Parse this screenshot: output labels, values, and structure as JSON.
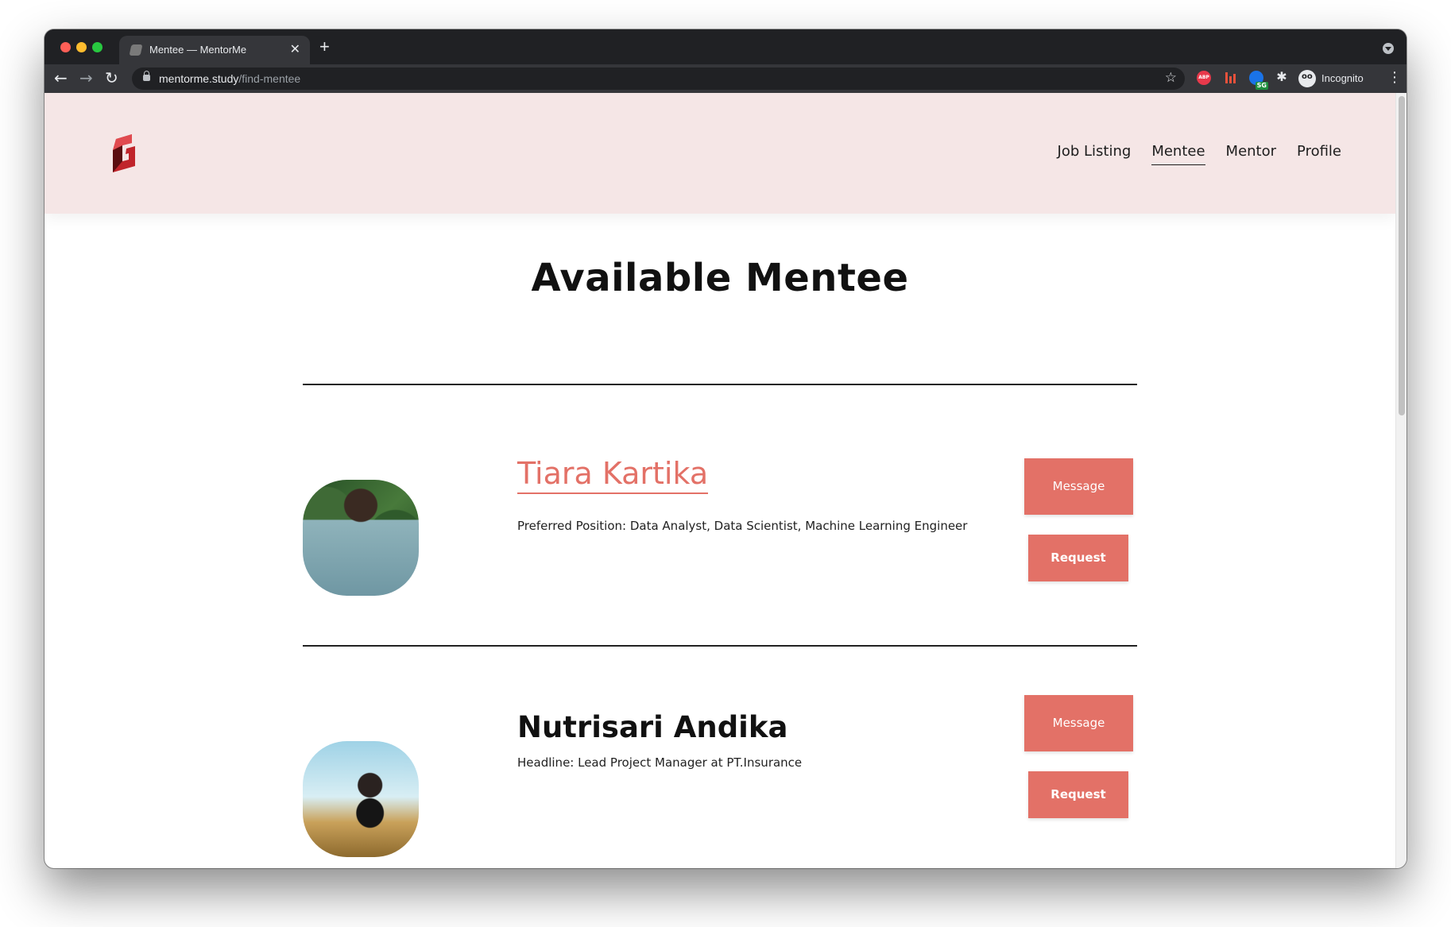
{
  "browser": {
    "tab_title": "Mentee — MentorMe",
    "tab_close": "✕",
    "new_tab": "+",
    "url_host": "mentorme.study",
    "url_path": "/find-mentee",
    "profile_label": "Incognito",
    "extensions": [
      "ABP",
      "bars-extension",
      "SG",
      "puzzle-icon"
    ],
    "sg_badge": "SG",
    "abp_label": "ABP"
  },
  "site": {
    "nav": [
      "Job Listing",
      "Mentee",
      "Mentor",
      "Profile"
    ],
    "active_nav": "Mentee",
    "page_title": "Available Mentee"
  },
  "mentees": [
    {
      "name": "Tiara Kartika",
      "detail": "Preferred Position: Data Analyst, Data Scientist, Machine Learning Engineer",
      "message_label": "Message",
      "request_label": "Request"
    },
    {
      "name": "Nutrisari Andika",
      "detail": "Headline: Lead Project Manager at PT.Insurance",
      "message_label": "Message",
      "request_label": "Request"
    }
  ],
  "colors": {
    "accent": "#e37167",
    "header_bg": "#f5e6e6",
    "logo_red": "#c0242b"
  }
}
